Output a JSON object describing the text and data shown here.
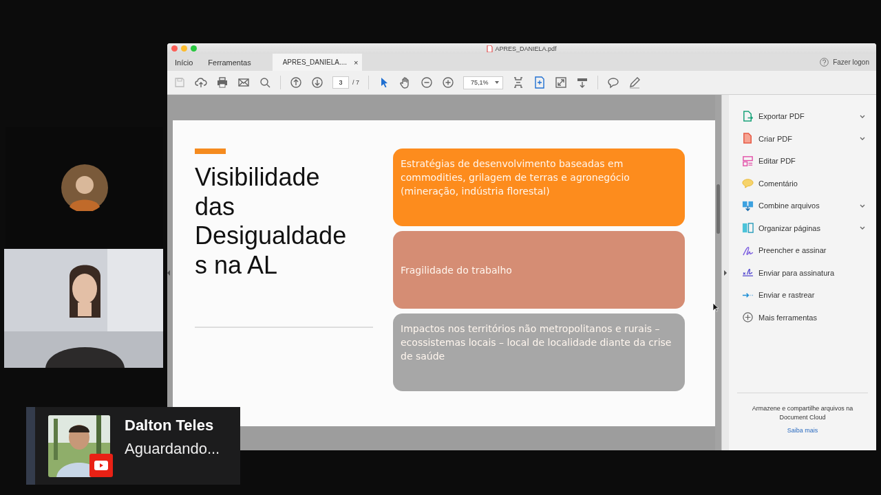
{
  "window": {
    "title": "APRES_DANIELA.pdf",
    "account": "Fazer logon"
  },
  "tabs": [
    {
      "label": "Início",
      "selected": false
    },
    {
      "label": "Ferramentas",
      "selected": false
    },
    {
      "label": "APRES_DANIELA....",
      "selected": true,
      "close": "×"
    }
  ],
  "toolbar": {
    "page": "3",
    "total": "/ 7",
    "zoom": "75,1%"
  },
  "slide": {
    "title_lines": [
      "Visibilidade",
      "das",
      "Desigualdade",
      "s na AL"
    ],
    "boxes": [
      {
        "text": "Estratégias de desenvolvimento baseadas em commodities, grilagem de terras e agronegócio (mineração, indústria florestal)",
        "color": "#fd8c1d",
        "kind": "top"
      },
      {
        "text": "Fragilidade do trabalho",
        "color": "#d58d74",
        "kind": "centered"
      },
      {
        "text": "Impactos nos territórios não metropolitanos e rurais – ecossistemas locais – local de localidade diante da crise de saúde",
        "color": "#a7a7a7",
        "kind": "top"
      }
    ]
  },
  "tools": [
    {
      "label": "Exportar PDF",
      "expandable": true
    },
    {
      "label": "Criar PDF",
      "expandable": true
    },
    {
      "label": "Editar PDF",
      "expandable": false
    },
    {
      "label": "Comentário",
      "expandable": false
    },
    {
      "label": "Combine arquivos",
      "expandable": true
    },
    {
      "label": "Organizar páginas",
      "expandable": true
    },
    {
      "label": "Preencher e assinar",
      "expandable": false
    },
    {
      "label": "Enviar para assinatura",
      "expandable": false
    },
    {
      "label": "Enviar e rastrear",
      "expandable": false
    },
    {
      "label": "Mais ferramentas",
      "expandable": false
    }
  ],
  "cloud": {
    "text": "Armazene e compartilhe arquivos na Document Cloud",
    "link": "Saiba mais"
  },
  "guest": {
    "name": "Dalton Teles",
    "status": "Aguardando..."
  }
}
